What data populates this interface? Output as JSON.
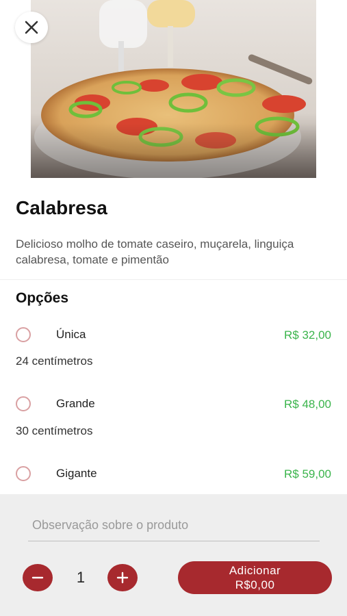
{
  "product": {
    "title": "Calabresa",
    "description": "Delicioso molho de tomate caseiro, muçarela, linguiça calabresa, tomate e pimentão"
  },
  "options": {
    "section_title": "Opções",
    "items": [
      {
        "name": "Única",
        "price": "R$ 32,00",
        "subtitle": "24 centímetros"
      },
      {
        "name": "Grande",
        "price": "R$ 48,00",
        "subtitle": "30 centímetros"
      },
      {
        "name": "Gigante",
        "price": "R$ 59,00"
      }
    ]
  },
  "observation": {
    "placeholder": "Observação sobre o produto"
  },
  "quantity": {
    "value": "1"
  },
  "add_button": {
    "label": "Adicionar",
    "total": "R$0,00"
  },
  "icons": {
    "close": "close-icon",
    "minus": "minus-icon",
    "plus": "plus-icon"
  },
  "colors": {
    "accent": "#a7292e",
    "price": "#3ab44b",
    "radio": "#d9a0a2"
  }
}
